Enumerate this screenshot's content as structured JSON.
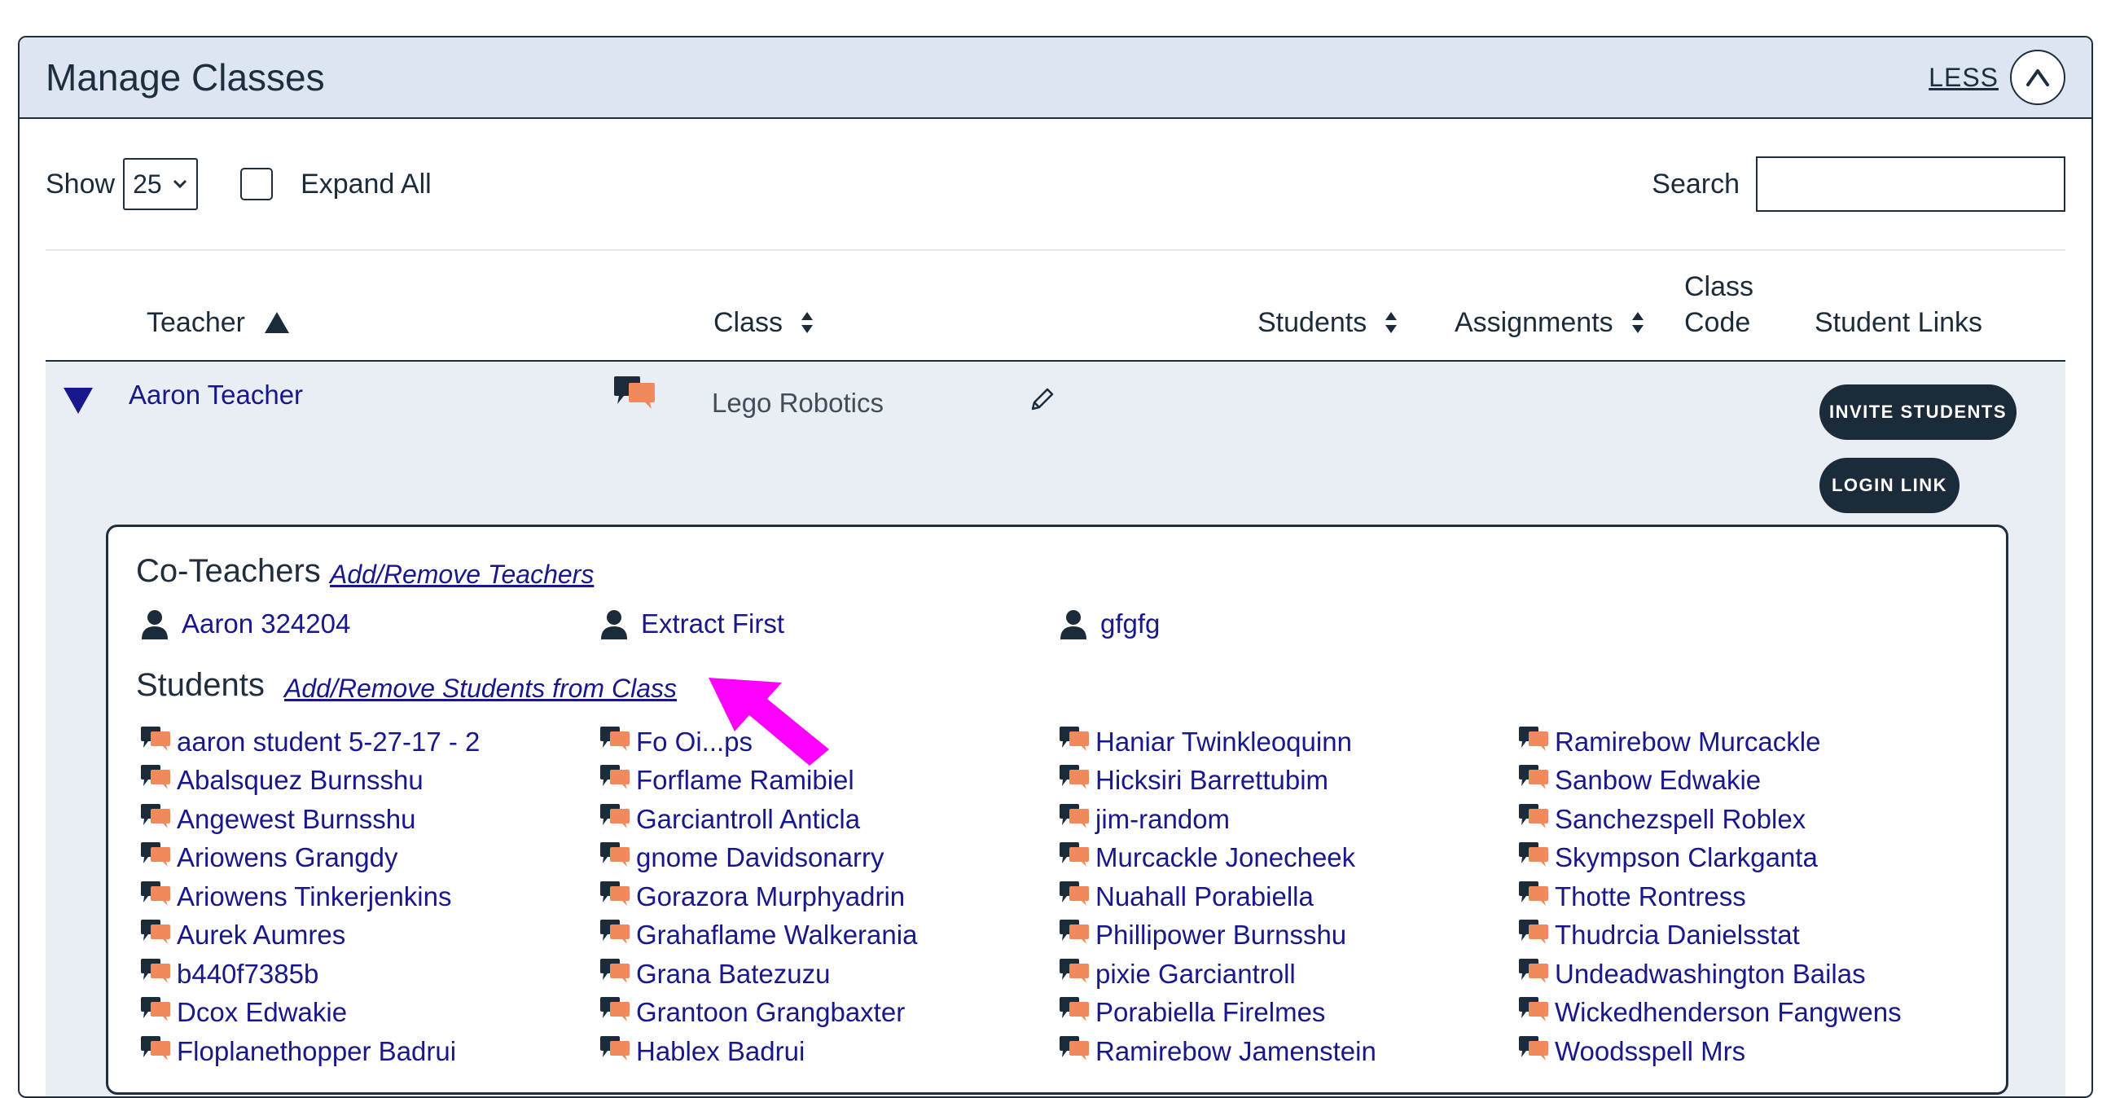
{
  "header": {
    "title": "Manage Classes",
    "less_label": "LESS"
  },
  "controls": {
    "show_label": "Show",
    "show_value": "25",
    "expand_all_label": "Expand All",
    "search_label": "Search",
    "search_value": ""
  },
  "columns": {
    "teacher": "Teacher",
    "class": "Class",
    "students": "Students",
    "assignments": "Assignments",
    "class_code_line1": "Class",
    "class_code_line2": "Code",
    "student_links": "Student Links"
  },
  "row": {
    "teacher": "Aaron Teacher",
    "class_name": "Lego Robotics",
    "invite_label": "INVITE STUDENTS",
    "login_label": "LOGIN LINK"
  },
  "details": {
    "coteachers_title": "Co-Teachers",
    "coteachers_link": "Add/Remove Teachers",
    "coteachers": [
      "Aaron 324204",
      "Extract First",
      "gfgfg"
    ],
    "students_title": "Students",
    "students_link": "Add/Remove Students from Class",
    "students": [
      [
        "aaron student 5-27-17 - 2",
        "Abalsquez Burnsshu",
        "Angewest Burnsshu",
        "Ariowens Grangdy",
        "Ariowens Tinkerjenkins",
        "Aurek Aumres",
        "b440f7385b",
        "Dcox Edwakie",
        "Floplanethopper Badrui"
      ],
      [
        "Fo Oi...ps",
        "Forflame Ramibiel",
        "Garciantroll Anticla",
        "gnome Davidsonarry",
        "Gorazora Murphyadrin",
        "Grahaflame Walkerania",
        "Grana Batezuzu",
        "Grantoon Grangbaxter",
        "Hablex Badrui"
      ],
      [
        "Haniar Twinkleoquinn",
        "Hicksiri Barrettubim",
        "jim-random",
        "Murcackle Jonecheek",
        "Nuahall Porabiella",
        "Phillipower Burnsshu",
        "pixie Garciantroll",
        "Porabiella Firelmes",
        "Ramirebow Jamenstein"
      ],
      [
        "Ramirebow Murcackle",
        "Sanbow Edwakie",
        "Sanchezspell Roblex",
        "Skympson Clarkganta",
        "Thotte Rontress",
        "Thudrcia Danielsstat",
        "Undeadwashington Bailas",
        "Wickedhenderson Fangwens",
        "Woodsspell Mrs"
      ]
    ]
  },
  "colors": {
    "header_bg": "#dbe6f2",
    "link": "#18188c",
    "dark": "#1c2b3a",
    "chat_accent": "#f08a5d",
    "annotation_arrow": "#ff00ff"
  }
}
